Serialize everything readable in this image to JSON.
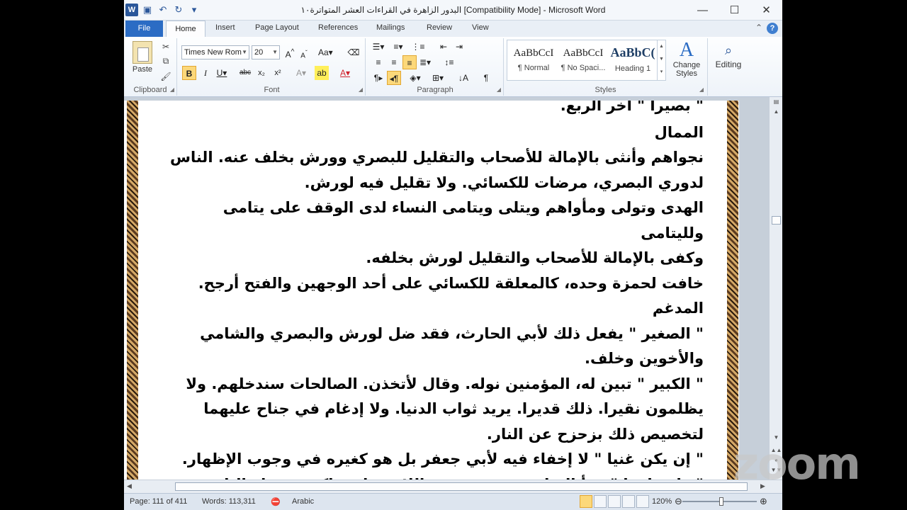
{
  "window": {
    "title": "البدور الزاهرة في القراءات العشر المتواترة١٠ [Compatibility Mode] - Microsoft Word",
    "qat_icons": [
      "word-logo",
      "save-icon",
      "undo-icon",
      "redo-icon",
      "customize-icon"
    ]
  },
  "tabs": [
    "File",
    "Home",
    "Insert",
    "Page Layout",
    "References",
    "Mailings",
    "Review",
    "View"
  ],
  "ribbon": {
    "clipboard": {
      "label": "Clipboard",
      "paste": "Paste"
    },
    "font": {
      "label": "Font",
      "family": "Times New Rom",
      "size": "20"
    },
    "paragraph": {
      "label": "Paragraph"
    },
    "styles": {
      "label": "Styles",
      "items": [
        {
          "sample": "AaBbCcI",
          "name": "¶ Normal"
        },
        {
          "sample": "AaBbCcI",
          "name": "¶ No Spaci..."
        },
        {
          "sample": "AaBbC(",
          "name": "Heading 1"
        }
      ],
      "change_styles": "Change Styles"
    },
    "editing": {
      "label": "Editing"
    }
  },
  "document": {
    "lines": [
      "\" بصيرا \" آخر الربع.",
      "الممال",
      "نجواهم وأنثى بالإمالة للأصحاب والتقليل للبصري وورش بخلف عنه. الناس",
      "لدوري البصري، مرضات للكسائي. ولا تقليل فيه لورش.",
      "الهدى وتولى ومأواهم ويتلى ويتامى النساء لدى الوقف على يتامى ولليتامى",
      "وكفى بالإمالة للأصحاب والتقليل لورش بخلفه.",
      "خافت لحمزة وحده، كالمعلقة للكسائي على أحد الوجهين والفتح أرجح.",
      "المدغم",
      "\" الصغير \" يفعل ذلك لأبي الحارث، فقد ضل لورش والبصري والشامي",
      "والأخوين وخلف.",
      "\" الكبير \" تبين له، المؤمنين نوله. وقال لأتخذن. الصالحات سندخلهم. ولا",
      "يظلمون نقيرا. ذلك قديرا. يريد ثواب الدنيا. ولا إدغام في جناح عليهما",
      "لتخصيص ذلك بزحزح عن النار.",
      "\" إن يكن غنيا \" لا إخفاء فيه لأبي جعفر بل هو كغيره في وجوب الإظهار.",
      "\" وإن تلووا \" قرأ الشامي وحمزة بضم اللام وواو ساكنة بعدها والباقون"
    ]
  },
  "status": {
    "page": "Page: 111 of 411",
    "words": "Words: 113,311",
    "language": "Arabic",
    "zoom": "120%"
  },
  "overlay": {
    "zoom_logo": "zoom"
  },
  "colors": {
    "file_tab": "#2b6cc4",
    "highlight": "#fcd87a"
  }
}
